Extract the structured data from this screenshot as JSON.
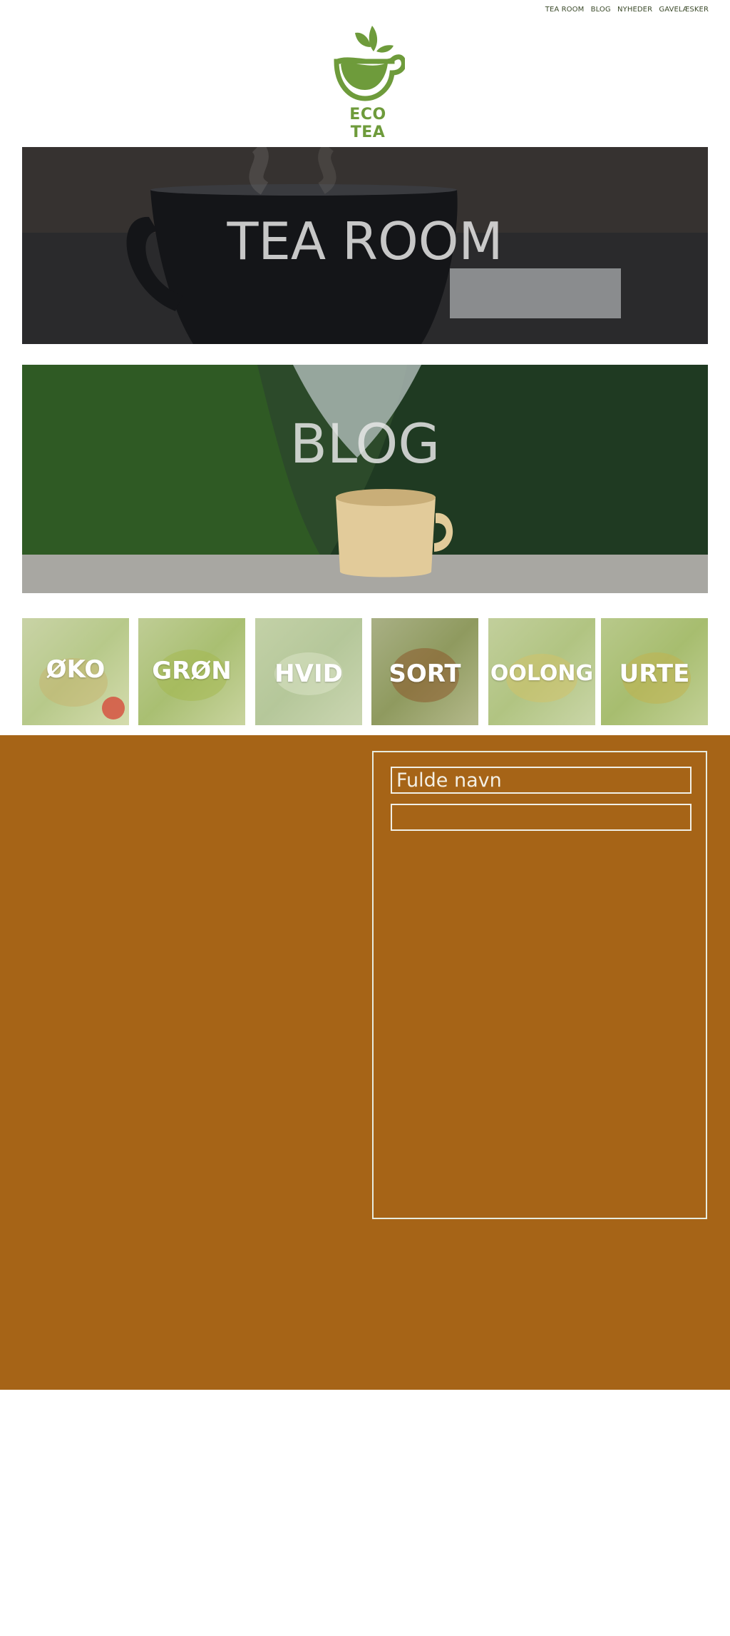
{
  "nav": {
    "items": [
      "TEA ROOM",
      "BLOG",
      "NYHEDER",
      "GAVELÆSKER"
    ]
  },
  "logo": {
    "text": "ECO TEA"
  },
  "banners": {
    "tea_room": "TEA ROOM",
    "blog": "BLOG"
  },
  "categories": [
    "ØKO",
    "GRØN",
    "HVID",
    "SORT",
    "OOLONG",
    "URTE"
  ],
  "form": {
    "name_label": "Fulde navn"
  },
  "colors": {
    "brand_green": "#6e9b3b",
    "section_brown": "#a66417",
    "form_border": "#e7ecdf"
  }
}
